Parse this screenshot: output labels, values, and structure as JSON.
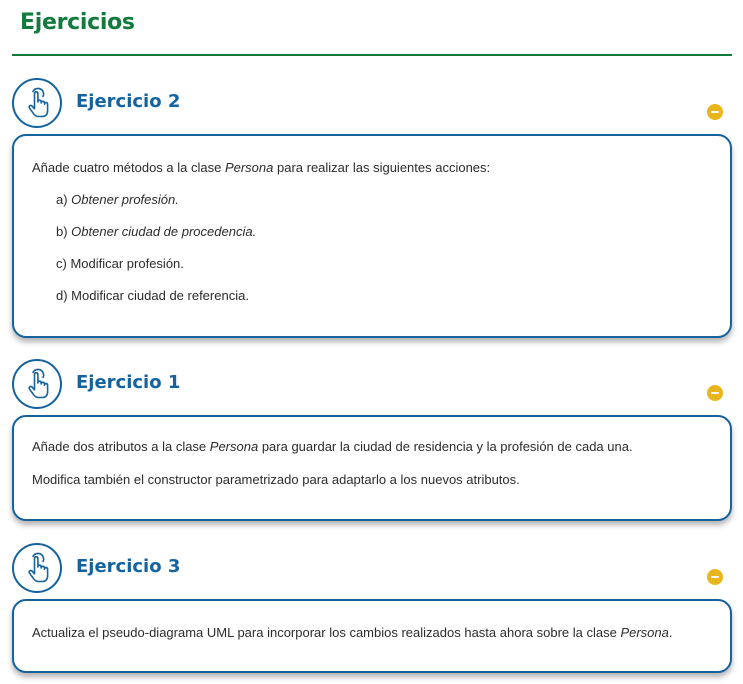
{
  "page_title": "Ejercicios",
  "accent_green": "#127a3c",
  "accent_blue": "#15639e",
  "toggle_color": "#e9b41c",
  "exercises": [
    {
      "title": "Ejercicio 2",
      "icon": "hand-touch-icon",
      "toggle": "collapse-minus-icon",
      "intro_before": "Añade cuatro métodos a la clase ",
      "intro_em": "Persona",
      "intro_after": " para realizar las siguientes acciones:",
      "items": [
        {
          "prefix": "a) ",
          "text": "Obtener profesión.",
          "italic": true
        },
        {
          "prefix": "b) ",
          "text": "Obtener ciudad de procedencia.",
          "italic": true
        },
        {
          "prefix": "c) ",
          "text": "Modificar profesión.",
          "italic": false
        },
        {
          "prefix": "d) ",
          "text": "Modificar ciudad de referencia.",
          "italic": false
        }
      ]
    },
    {
      "title": "Ejercicio 1",
      "icon": "hand-touch-icon",
      "toggle": "collapse-minus-icon",
      "line1_before": "Añade dos atributos a la clase ",
      "line1_em": "Persona",
      "line1_after": " para guardar la ciudad de residencia y la profesión de cada una.",
      "line2": "Modifica también el constructor parametrizado para adaptarlo a los nuevos atributos."
    },
    {
      "title": "Ejercicio 3",
      "icon": "hand-touch-icon",
      "toggle": "collapse-minus-icon",
      "line1_before": "Actualiza el pseudo-diagrama UML para incorporar los cambios realizados hasta ahora sobre la clase ",
      "line1_em": "Persona",
      "line1_after": "."
    }
  ]
}
